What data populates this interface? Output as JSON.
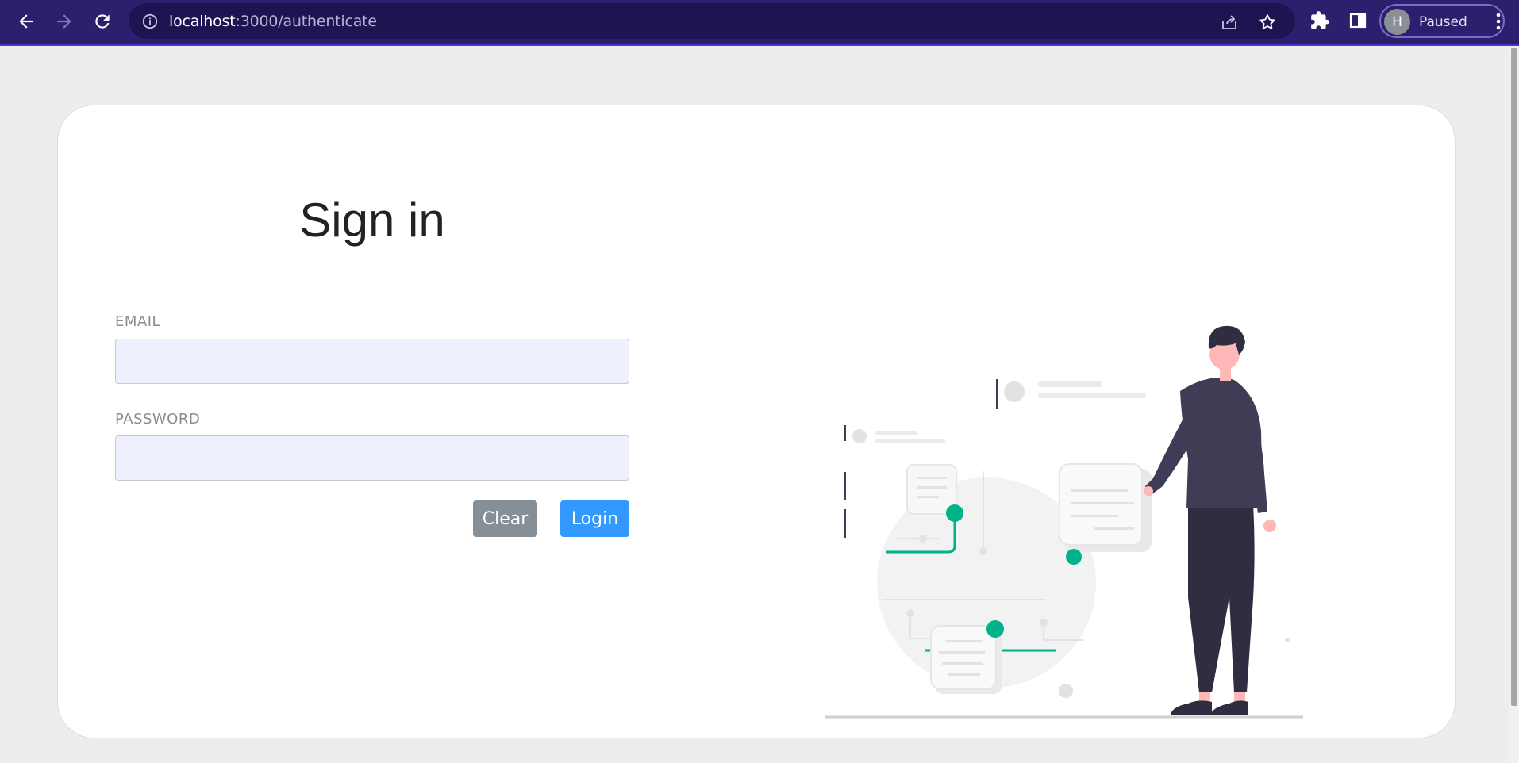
{
  "browser": {
    "url_host": "localhost",
    "url_path": ":3000/authenticate",
    "profile_initial": "H",
    "profile_status": "Paused"
  },
  "page": {
    "title": "Sign in",
    "email_label": "EMAIL",
    "password_label": "PASSWORD",
    "email_value": "",
    "password_value": "",
    "clear_button": "Clear",
    "login_button": "Login"
  },
  "colors": {
    "chrome": "#2c1f6e",
    "accent_green": "#00b28a",
    "login_blue": "#3399ff",
    "clear_gray": "#868e96",
    "field_bg": "#eef0fd"
  }
}
